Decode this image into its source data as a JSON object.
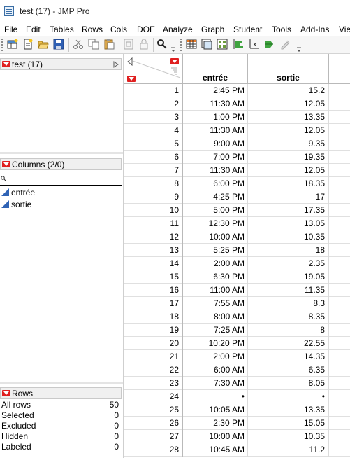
{
  "window": {
    "title": "test (17) - JMP Pro"
  },
  "menu": [
    "File",
    "Edit",
    "Tables",
    "Rows",
    "Cols",
    "DOE",
    "Analyze",
    "Graph",
    "Student",
    "Tools",
    "Add-Ins",
    "View"
  ],
  "table_panel": {
    "title": "test (17)"
  },
  "columns_panel": {
    "title": "Columns (2/0)",
    "search_placeholder": "",
    "columns": [
      "entrée",
      "sortie"
    ]
  },
  "rows_panel": {
    "title": "Rows",
    "stats": [
      {
        "label": "All rows",
        "value": "50"
      },
      {
        "label": "Selected",
        "value": "0"
      },
      {
        "label": "Excluded",
        "value": "0"
      },
      {
        "label": "Hidden",
        "value": "0"
      },
      {
        "label": "Labeled",
        "value": "0"
      }
    ]
  },
  "grid": {
    "headers": [
      "entrée",
      "sortie"
    ],
    "rows": [
      [
        "1",
        "2:45 PM",
        "15.2"
      ],
      [
        "2",
        "11:30 AM",
        "12.05"
      ],
      [
        "3",
        "1:00 PM",
        "13.35"
      ],
      [
        "4",
        "11:30 AM",
        "12.05"
      ],
      [
        "5",
        "9:00 AM",
        "9.35"
      ],
      [
        "6",
        "7:00 PM",
        "19.35"
      ],
      [
        "7",
        "11:30 AM",
        "12.05"
      ],
      [
        "8",
        "6:00 PM",
        "18.35"
      ],
      [
        "9",
        "4:25 PM",
        "17"
      ],
      [
        "10",
        "5:00 PM",
        "17.35"
      ],
      [
        "11",
        "12:30 PM",
        "13.05"
      ],
      [
        "12",
        "10:00 AM",
        "10.35"
      ],
      [
        "13",
        "5:25 PM",
        "18"
      ],
      [
        "14",
        "2:00 AM",
        "2.35"
      ],
      [
        "15",
        "6:30 PM",
        "19.05"
      ],
      [
        "16",
        "11:00 AM",
        "11.35"
      ],
      [
        "17",
        "7:55 AM",
        "8.3"
      ],
      [
        "18",
        "8:00 AM",
        "8.35"
      ],
      [
        "19",
        "7:25 AM",
        "8"
      ],
      [
        "20",
        "10:20 PM",
        "22.55"
      ],
      [
        "21",
        "2:00 PM",
        "14.35"
      ],
      [
        "22",
        "6:00 AM",
        "6.35"
      ],
      [
        "23",
        "7:30 AM",
        "8.05"
      ],
      [
        "24",
        "•",
        "•"
      ],
      [
        "25",
        "10:05 AM",
        "13.35"
      ],
      [
        "26",
        "2:30 PM",
        "15.05"
      ],
      [
        "27",
        "10:00 AM",
        "10.35"
      ],
      [
        "28",
        "10:45 AM",
        "11.2"
      ]
    ]
  },
  "colors": {
    "accent_red": "#e02020",
    "column_icon": "#2f63b5",
    "header_bg": "#f0f0f0"
  },
  "icons": [
    "new-data-table-icon",
    "new-script-icon",
    "open-icon",
    "save-icon",
    "cut-icon",
    "copy-icon",
    "paste-icon",
    "journal-icon",
    "lock-icon",
    "search-icon",
    "data-grid-icon",
    "subset-icon",
    "summary-icon",
    "graph-builder-icon",
    "distribution-icon",
    "fit-y-by-x-icon",
    "customize-icon"
  ]
}
